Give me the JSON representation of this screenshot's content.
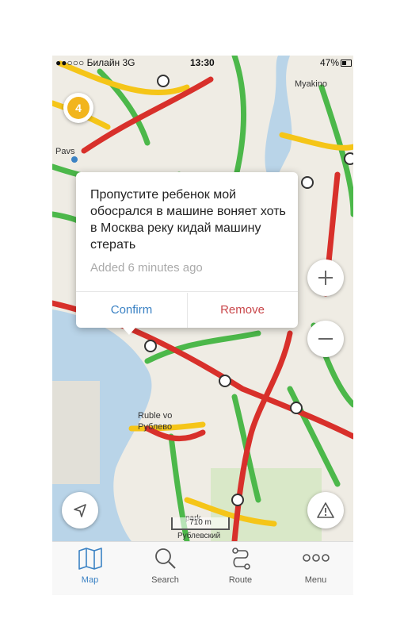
{
  "status": {
    "carrier": "●●○○○ Билайн 3G",
    "time": "13:30",
    "battery": "47%"
  },
  "map": {
    "labels": [
      "Pavs",
      "Myakino",
      "Ruble vo",
      "Рублево",
      "park",
      "Рублевский"
    ],
    "incidents_badge": "4",
    "scale": "710 m"
  },
  "popup": {
    "message": "Пропустите ребенок мой обосрался в машине воняет хоть в Москва реку кидай машину стерать",
    "time": "Added 6 minutes ago",
    "confirm": "Confirm",
    "remove": "Remove"
  },
  "tabs": [
    {
      "label": "Map",
      "icon": "map-icon"
    },
    {
      "label": "Search",
      "icon": "search-icon"
    },
    {
      "label": "Route",
      "icon": "route-icon"
    },
    {
      "label": "Menu",
      "icon": "menu-icon"
    }
  ],
  "colors": {
    "traffic_green": "#4cb84a",
    "traffic_yellow": "#f5c518",
    "traffic_red": "#d8302b",
    "accent_blue": "#3b82c4",
    "remove_red": "#c9474b",
    "badge_orange": "#f2b51d"
  }
}
